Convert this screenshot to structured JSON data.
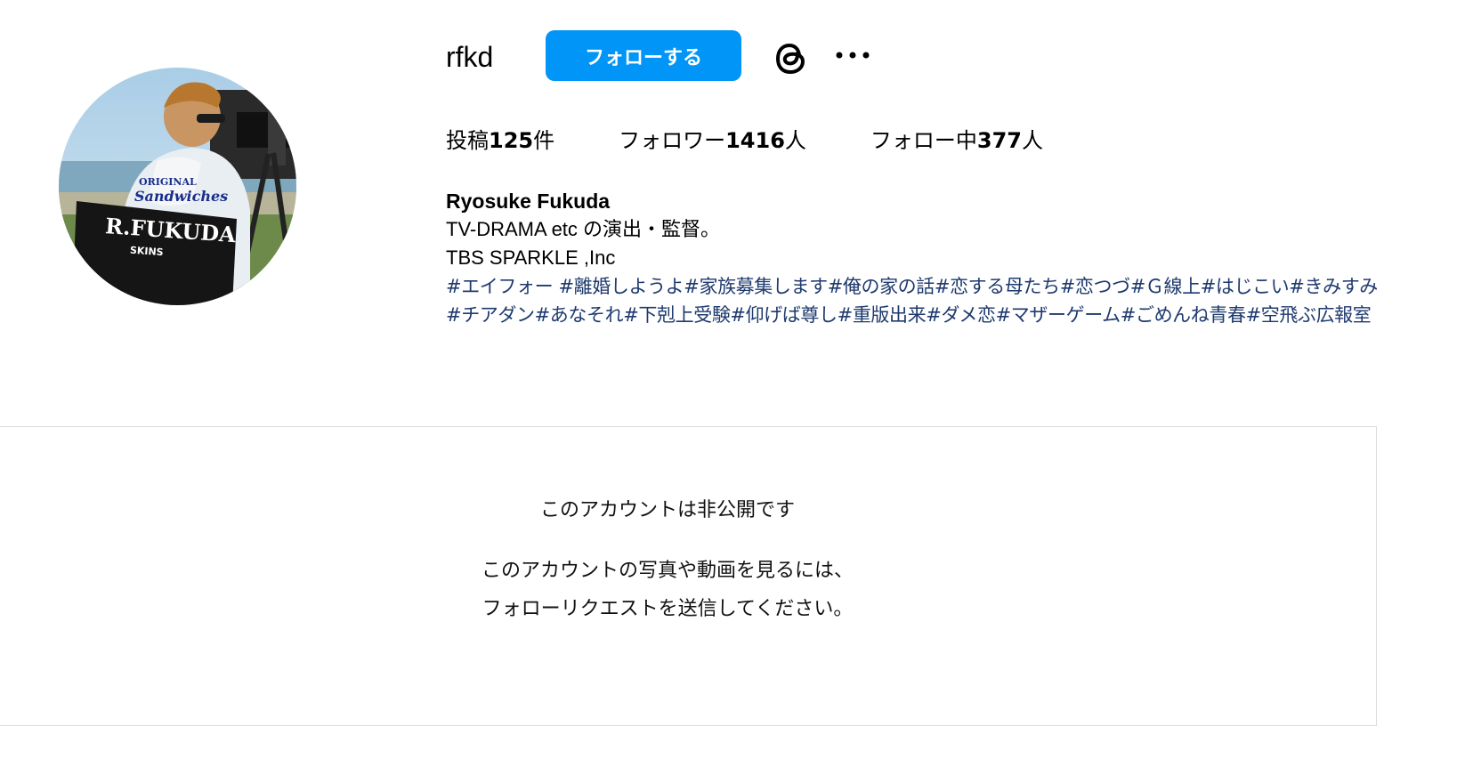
{
  "profile": {
    "username": "rfkd",
    "follow_label": "フォローする",
    "avatar_text_chair": "R.FUKUDA",
    "avatar_text_brand": "SKINS",
    "avatar_text_shirt": "Sandwiches"
  },
  "stats": [
    {
      "prefix": "投稿",
      "num": "125",
      "suffix": "件"
    },
    {
      "prefix": "フォロワー",
      "num": "1416",
      "suffix": "人"
    },
    {
      "prefix": "フォロー中",
      "num": "377",
      "suffix": "人"
    }
  ],
  "bio": {
    "name": "Ryosuke Fukuda",
    "line1": "TV-DRAMA etc の演出・監督。",
    "line2": "TBS SPARKLE ,Inc",
    "hashtags": [
      "#エイフォー",
      " #離婚しようよ",
      "#家族募集します",
      "#俺の家の話",
      "#恋する母たち",
      "#恋つづ",
      "#Ｇ線上",
      "#はじこい",
      "#きみすみ",
      "#チアダン",
      "#あなそれ",
      "#下剋上受験",
      "#仰げば尊し",
      "#重版出来",
      "#ダメ恋",
      "#マザーゲーム",
      "#ごめんね青春",
      "#空飛ぶ広報室"
    ]
  },
  "private": {
    "title": "このアカウントは非公開です",
    "description": "このアカウントの写真や動画を見るには、フォローリクエストを送信してください。"
  },
  "icons": {
    "threads": "threads-icon",
    "more": "more-options-icon"
  },
  "colors": {
    "accent": "#0095f6",
    "hashtag": "#1e3a6e",
    "border": "#dbdbdb"
  }
}
